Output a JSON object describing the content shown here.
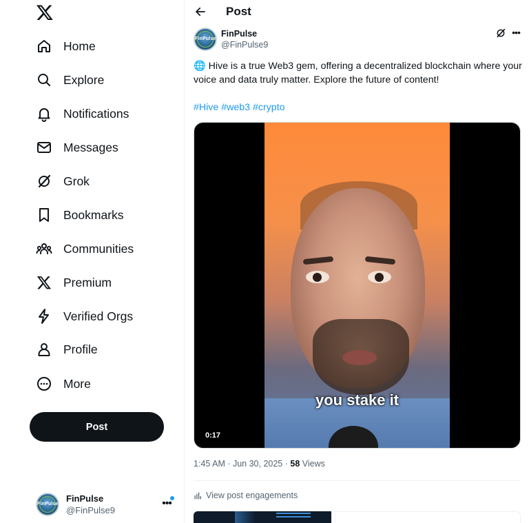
{
  "sidebar": {
    "logo_icon": "x-logo-icon",
    "items": [
      {
        "label": "Home",
        "icon": "home-icon"
      },
      {
        "label": "Explore",
        "icon": "search-icon"
      },
      {
        "label": "Notifications",
        "icon": "bell-icon"
      },
      {
        "label": "Messages",
        "icon": "envelope-icon"
      },
      {
        "label": "Grok",
        "icon": "grok-icon"
      },
      {
        "label": "Bookmarks",
        "icon": "bookmark-icon"
      },
      {
        "label": "Communities",
        "icon": "people-icon"
      },
      {
        "label": "Premium",
        "icon": "x-logo-icon"
      },
      {
        "label": "Verified Orgs",
        "icon": "lightning-icon"
      },
      {
        "label": "Profile",
        "icon": "person-icon"
      },
      {
        "label": "More",
        "icon": "more-circle-icon"
      }
    ],
    "post_button": "Post",
    "account": {
      "display_name": "FinPulse",
      "handle": "@FinPulse9",
      "avatar_text": "FinPulse"
    }
  },
  "header": {
    "title": "Post"
  },
  "post": {
    "author": {
      "display_name": "FinPulse",
      "handle": "@FinPulse9",
      "avatar_text": "FinPulse"
    },
    "text": "🌐 Hive is a true Web3 gem, offering a decentralized blockchain where your voice and data truly matter. Explore the future of content!",
    "hashtags": [
      "#Hive",
      "#web3",
      "#crypto"
    ],
    "video": {
      "caption": "you stake it",
      "duration": "0:17"
    },
    "timestamp": "1:45 AM · Jun 30, 2025 · ",
    "views_count": "58",
    "views_label": " Views",
    "engagements_link": "View post engagements"
  },
  "colors": {
    "accent": "#1d9bf0",
    "text": "#0f1419",
    "muted": "#536471"
  }
}
